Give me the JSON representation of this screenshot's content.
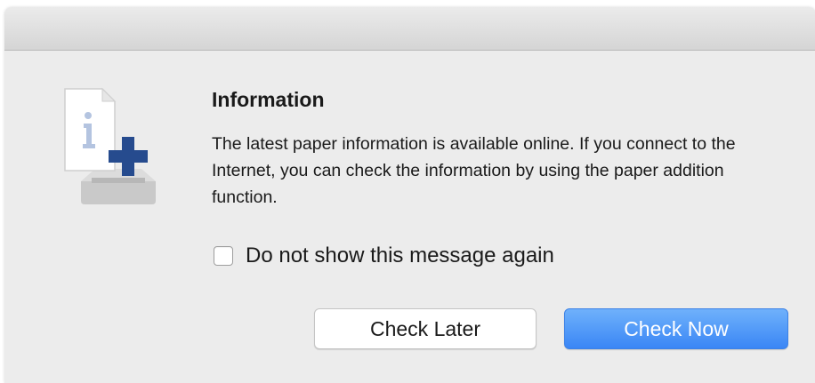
{
  "dialog": {
    "title": "Information",
    "message": "The latest paper information is available online. If you connect to the Internet, you can check the information by using the paper addition function.",
    "icon": "paper-info-add-icon",
    "checkbox": {
      "label": "Do not show this message again",
      "checked": false
    },
    "buttons": {
      "check_later": "Check Later",
      "check_now": "Check Now"
    },
    "colors": {
      "background": "#ececec",
      "accent": "#3a86f5",
      "icon_plus": "#264b8e"
    }
  }
}
